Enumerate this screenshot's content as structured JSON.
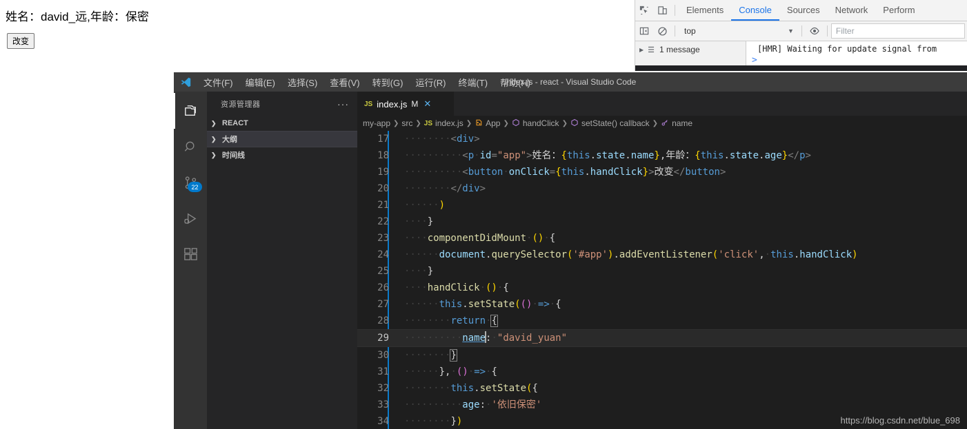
{
  "page": {
    "text": "姓名：david_远,年龄：保密",
    "button_label": "改变"
  },
  "devtools": {
    "tabs": [
      {
        "label": "Elements",
        "active": false
      },
      {
        "label": "Console",
        "active": true
      },
      {
        "label": "Sources",
        "active": false
      },
      {
        "label": "Network",
        "active": false
      },
      {
        "label": "Perform",
        "active": false
      }
    ],
    "icons": {
      "inspect": "inspect-element-icon",
      "device": "device-toolbar-icon",
      "sidebar": "console-sidebar-icon",
      "clear": "clear-console-icon",
      "eye": "live-expression-icon"
    },
    "context_value": "top",
    "filter_placeholder": "Filter",
    "message_count": "1 message",
    "log_text": "[HMR] Waiting for update signal from",
    "prompt": ">"
  },
  "vscode": {
    "title": "index.js - react - Visual Studio Code",
    "menu": [
      "文件(F)",
      "编辑(E)",
      "选择(S)",
      "查看(V)",
      "转到(G)",
      "运行(R)",
      "终端(T)",
      "帮助(H)"
    ],
    "activitybar": [
      {
        "name": "explorer-icon",
        "badge": ""
      },
      {
        "name": "search-icon",
        "badge": ""
      },
      {
        "name": "source-control-icon",
        "badge": "22"
      },
      {
        "name": "run-debug-icon",
        "badge": ""
      },
      {
        "name": "extensions-icon",
        "badge": ""
      }
    ],
    "sidebar": {
      "title": "资源管理器",
      "more": "···",
      "sections": [
        {
          "label": "REACT",
          "selected": false
        },
        {
          "label": "大纲",
          "selected": true
        },
        {
          "label": "时间线",
          "selected": false
        }
      ]
    },
    "tab": {
      "lang": "JS",
      "filename": "index.js",
      "modified": "M",
      "close": "✕"
    },
    "breadcrumb": [
      {
        "label": "my-app",
        "icon": ""
      },
      {
        "label": "src",
        "icon": ""
      },
      {
        "label": "index.js",
        "icon": "JS"
      },
      {
        "label": "App",
        "icon": "class"
      },
      {
        "label": "handClick",
        "icon": "method"
      },
      {
        "label": "setState() callback",
        "icon": "method"
      },
      {
        "label": "name",
        "icon": "property"
      }
    ],
    "watermark": "https://blog.csdn.net/blue_698",
    "code_lines": [
      {
        "num": "17",
        "current": false
      },
      {
        "num": "18",
        "current": false
      },
      {
        "num": "19",
        "current": false
      },
      {
        "num": "20",
        "current": false
      },
      {
        "num": "21",
        "current": false
      },
      {
        "num": "22",
        "current": false
      },
      {
        "num": "23",
        "current": false
      },
      {
        "num": "24",
        "current": false
      },
      {
        "num": "25",
        "current": false
      },
      {
        "num": "26",
        "current": false
      },
      {
        "num": "27",
        "current": false
      },
      {
        "num": "28",
        "current": false
      },
      {
        "num": "29",
        "current": true
      },
      {
        "num": "30",
        "current": false
      },
      {
        "num": "31",
        "current": false
      },
      {
        "num": "32",
        "current": false
      },
      {
        "num": "33",
        "current": false
      },
      {
        "num": "34",
        "current": false
      }
    ],
    "code_text": [
      "        <div>",
      "          <p id=\"app\">姓名：{this.state.name},年龄：{this.state.age}</p>",
      "          <button onClick={this.handClick}>改变</button>",
      "        </div>",
      "      )",
      "    }",
      "    componentDidMount () {",
      "      document.querySelector('#app').addEventListener('click', this.handClick)",
      "    }",
      "    handClick () {",
      "      this.setState(() => {",
      "        return {",
      "          name: \"david_yuan\"",
      "        }",
      "      }, () => {",
      "        this.setState({",
      "          age: '依旧保密'",
      "        })"
    ]
  }
}
